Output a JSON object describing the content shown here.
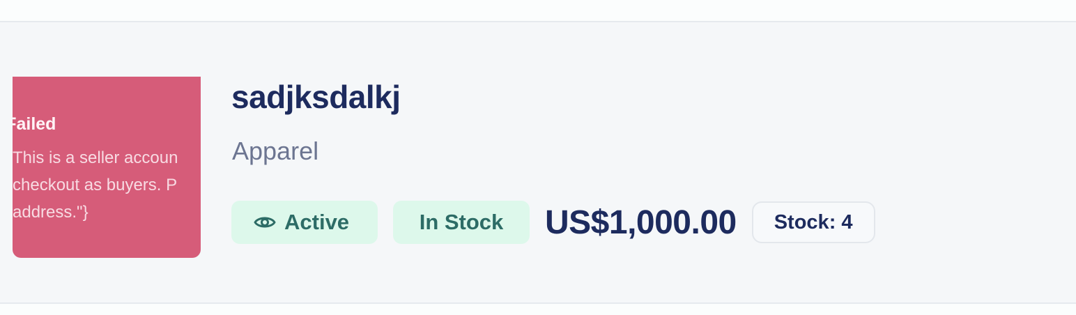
{
  "product": {
    "image_placeholder": {
      "title": "n Failed",
      "message": "This is a seller accoun\ncheckout as buyers. P\naddress.\"}"
    },
    "name": "sadjksdalkj",
    "category": "Apparel",
    "status": {
      "label": "Active",
      "icon": "eye-icon"
    },
    "availability": "In Stock",
    "price": "US$1,000.00",
    "stock_count": "Stock: 4"
  },
  "colors": {
    "title": "#1d2b5e",
    "badge_bg": "#ddf8eb",
    "badge_text": "#2d6c66",
    "thumb_bg": "#d65c79"
  }
}
